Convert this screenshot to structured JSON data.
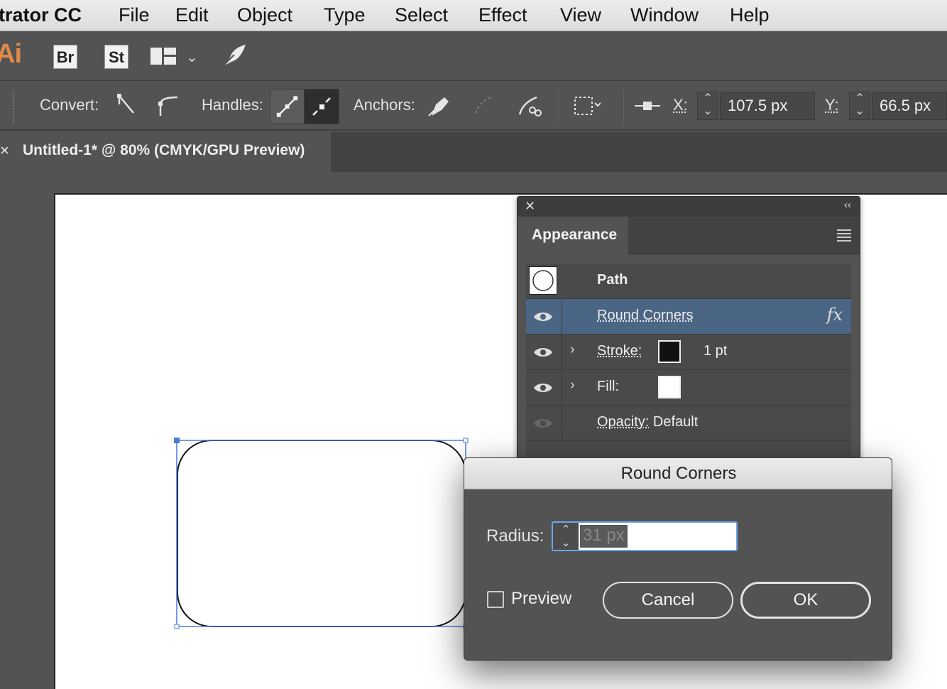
{
  "menubar": {
    "app_name": "trator CC",
    "items": [
      "File",
      "Edit",
      "Object",
      "Type",
      "Select",
      "Effect",
      "View",
      "Window",
      "Help"
    ]
  },
  "appbar": {
    "logo": "Ai",
    "bridge": "Br",
    "stock": "St"
  },
  "controlbar": {
    "convert_label": "Convert:",
    "handles_label": "Handles:",
    "anchors_label": "Anchors:",
    "x_label": "X:",
    "x_value": "107.5 px",
    "y_label": "Y:",
    "y_value": "66.5 px"
  },
  "document": {
    "close": "×",
    "tab_title": "Untitled-1* @ 80% (CMYK/GPU Preview)"
  },
  "appearance_panel": {
    "title": "Appearance",
    "rows": {
      "path": "Path",
      "round_corners": "Round Corners",
      "fx": "fx",
      "stroke_label": "Stroke:",
      "stroke_weight": "1 pt",
      "fill_label": "Fill:",
      "opacity_label": "Opacity:",
      "opacity_value": "Default"
    }
  },
  "dialog": {
    "title": "Round Corners",
    "radius_label": "Radius:",
    "radius_value": "31 px",
    "preview_label": "Preview",
    "preview_checked": false,
    "cancel_label": "Cancel",
    "ok_label": "OK"
  },
  "colors": {
    "ui_gray": "#535353",
    "selection_blue": "#4b6584",
    "accent": "#4a7bd6",
    "logo_orange": "#e08a4b"
  }
}
